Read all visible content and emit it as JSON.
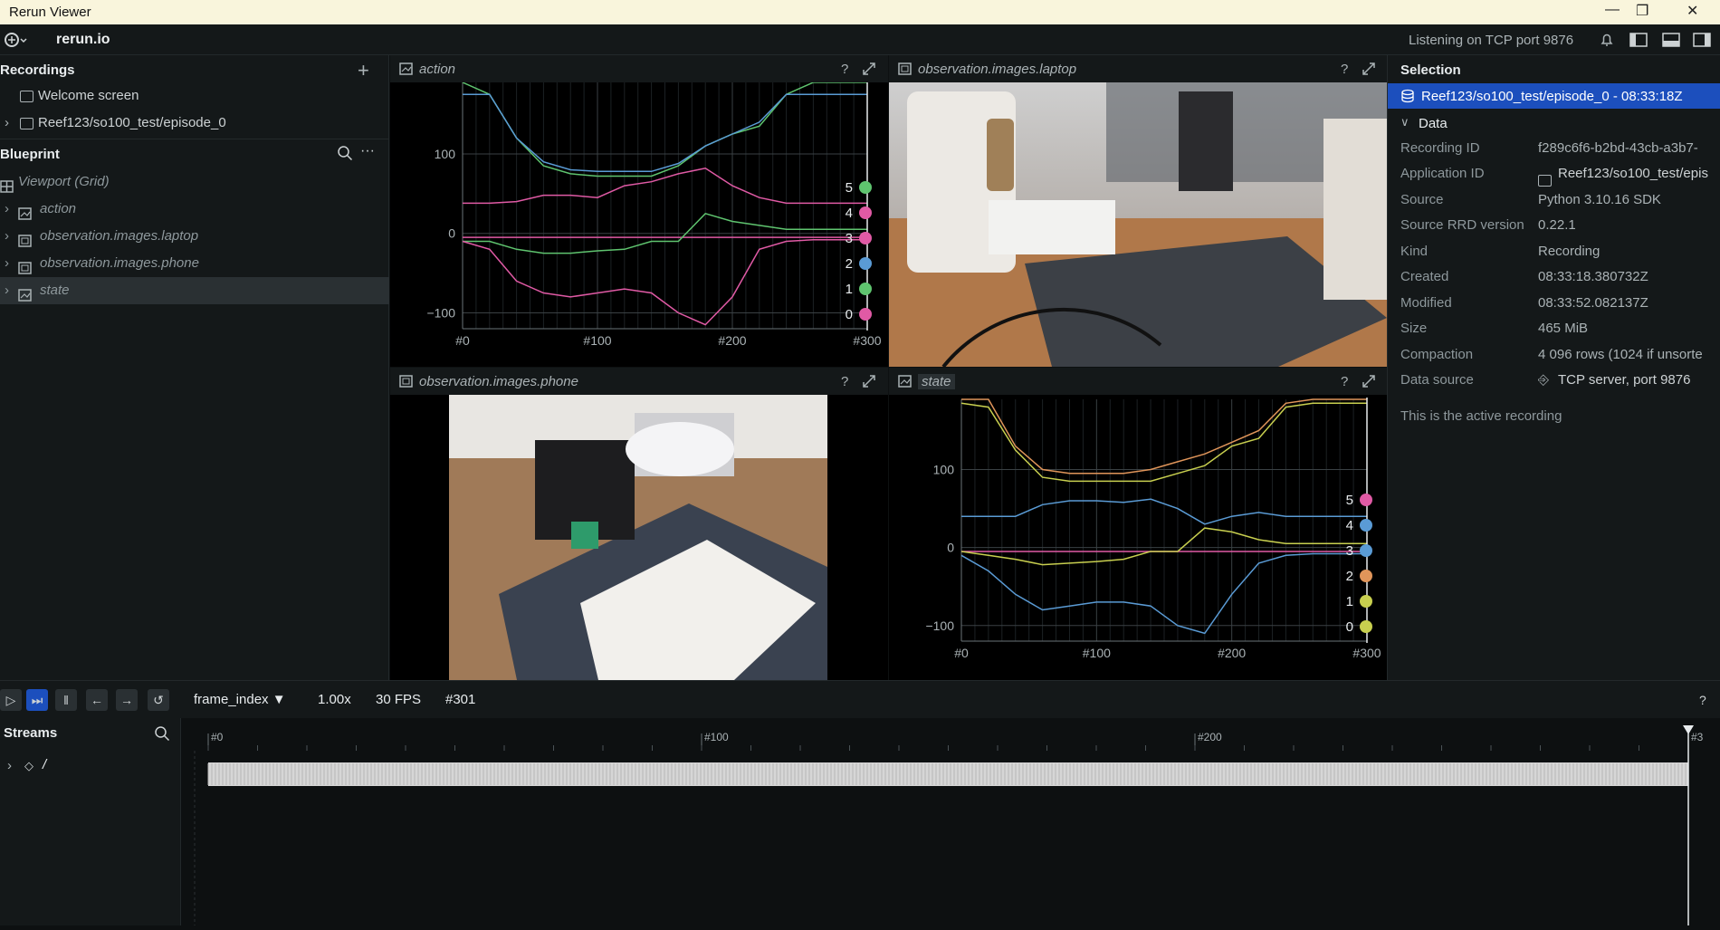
{
  "window": {
    "title": "Rerun Viewer",
    "minimize": "—",
    "restore": "❐",
    "close": "✕"
  },
  "topbar": {
    "logo": "rerun.io",
    "status": "Listening on TCP port 9876"
  },
  "recordings": {
    "header": "Recordings",
    "add_icon": "plus-icon",
    "items": [
      {
        "label": "Welcome screen",
        "icon": "screen-icon"
      },
      {
        "label": "Reef123/so100_test/episode_0",
        "icon": "screen-icon"
      }
    ]
  },
  "blueprint": {
    "header": "Blueprint",
    "items": [
      {
        "label": "Viewport (Grid)",
        "icon": "grid-icon"
      },
      {
        "label": "action",
        "icon": "chart-icon"
      },
      {
        "label": "observation.images.laptop",
        "icon": "image-icon"
      },
      {
        "label": "observation.images.phone",
        "icon": "image-icon"
      },
      {
        "label": "state",
        "icon": "chart-icon"
      }
    ]
  },
  "panels": {
    "action": {
      "title": "action"
    },
    "laptop": {
      "title": "observation.images.laptop"
    },
    "phone": {
      "title": "observation.images.phone"
    },
    "state": {
      "title": "state"
    },
    "help": "?"
  },
  "selection": {
    "header": "Selection",
    "selected": "Reef123/so100_test/episode_0 - 08:33:18Z",
    "section": "Data",
    "rows": [
      {
        "k": "Recording ID",
        "v": "f289c6f6-b2bd-43cb-a3b7-"
      },
      {
        "k": "Application ID",
        "v": "Reef123/so100_test/epis"
      },
      {
        "k": "Source",
        "v": "Python 3.10.16 SDK"
      },
      {
        "k": "Source RRD version",
        "v": "0.22.1"
      },
      {
        "k": "Kind",
        "v": "Recording"
      },
      {
        "k": "Created",
        "v": "08:33:18.380732Z"
      },
      {
        "k": "Modified",
        "v": "08:33:52.082137Z"
      },
      {
        "k": "Size",
        "v": "465 MiB"
      },
      {
        "k": "Compaction",
        "v": "4 096 rows (1024 if unsorte"
      },
      {
        "k": "Data source",
        "v": "TCP server, port 9876"
      }
    ],
    "note": "This is the active recording"
  },
  "timebar": {
    "timeline": "frame_index",
    "speed": "1.00x",
    "fps": "30 FPS",
    "frame": "#301",
    "help": "?"
  },
  "streams": {
    "header": "Streams",
    "root": "/"
  },
  "timeline": {
    "ticks": [
      "#0",
      "#100",
      "#200",
      "#3"
    ]
  },
  "chart_data": [
    {
      "type": "line",
      "panel": "action",
      "x_ticks": [
        "#0",
        "#100",
        "#200",
        "#300"
      ],
      "y_ticks": [
        "100",
        "0",
        "−100"
      ],
      "xlim": [
        0,
        300
      ],
      "ylim": [
        -120,
        190
      ],
      "series": [
        {
          "name": "5",
          "color": "#5fc46f",
          "x": [
            0,
            20,
            40,
            60,
            80,
            100,
            120,
            140,
            160,
            180,
            200,
            220,
            240,
            260,
            280,
            300
          ],
          "y": [
            195,
            175,
            120,
            85,
            75,
            72,
            72,
            72,
            85,
            110,
            125,
            135,
            175,
            195,
            195,
            195
          ]
        },
        {
          "name": "4",
          "color": "#e05aa5",
          "x": [
            0,
            20,
            40,
            60,
            80,
            100,
            120,
            140,
            160,
            180,
            200,
            220,
            240,
            260,
            280,
            300
          ],
          "y": [
            38,
            38,
            40,
            48,
            48,
            45,
            60,
            65,
            75,
            82,
            60,
            45,
            38,
            38,
            38,
            38
          ]
        },
        {
          "name": "3",
          "color": "#e05aa5",
          "x": [
            0,
            20,
            40,
            60,
            80,
            100,
            120,
            140,
            160,
            180,
            200,
            220,
            240,
            260,
            280,
            300
          ],
          "y": [
            -5,
            -5,
            -5,
            -5,
            -5,
            -5,
            -5,
            -5,
            -5,
            -5,
            -5,
            -5,
            -5,
            -5,
            -5,
            -5
          ]
        },
        {
          "name": "2",
          "color": "#5a9bd5",
          "x": [
            0,
            20,
            40,
            60,
            80,
            100,
            120,
            140,
            160,
            180,
            200,
            220,
            240,
            260,
            280,
            300
          ],
          "y": [
            175,
            175,
            120,
            90,
            80,
            78,
            78,
            78,
            88,
            110,
            125,
            140,
            175,
            175,
            175,
            175
          ]
        },
        {
          "name": "1",
          "color": "#5fc46f",
          "x": [
            0,
            20,
            40,
            60,
            80,
            100,
            120,
            140,
            160,
            180,
            200,
            220,
            240,
            260,
            280,
            300
          ],
          "y": [
            -10,
            -10,
            -20,
            -25,
            -25,
            -22,
            -20,
            -10,
            -10,
            25,
            15,
            10,
            5,
            5,
            5,
            5
          ]
        },
        {
          "name": "0",
          "color": "#e05aa5",
          "x": [
            0,
            20,
            40,
            60,
            80,
            100,
            120,
            140,
            160,
            180,
            200,
            220,
            240,
            260,
            280,
            300
          ],
          "y": [
            -10,
            -20,
            -60,
            -75,
            -80,
            -75,
            -70,
            -75,
            -100,
            -115,
            -80,
            -20,
            -10,
            -8,
            -8,
            -8
          ]
        }
      ]
    },
    {
      "type": "line",
      "panel": "state",
      "x_ticks": [
        "#0",
        "#100",
        "#200",
        "#300"
      ],
      "y_ticks": [
        "100",
        "0",
        "−100"
      ],
      "xlim": [
        0,
        300
      ],
      "ylim": [
        -120,
        190
      ],
      "series": [
        {
          "name": "5",
          "color": "#e05aa5",
          "x": [
            0,
            20,
            40,
            60,
            80,
            100,
            120,
            140,
            160,
            180,
            200,
            220,
            240,
            260,
            280,
            300
          ],
          "y": [
            -5,
            -5,
            -5,
            -5,
            -5,
            -5,
            -5,
            -5,
            -5,
            -5,
            -5,
            -5,
            -5,
            -5,
            -5,
            -5
          ]
        },
        {
          "name": "4",
          "color": "#5a9bd5",
          "x": [
            0,
            20,
            40,
            60,
            80,
            100,
            120,
            140,
            160,
            180,
            200,
            220,
            240,
            260,
            280,
            300
          ],
          "y": [
            40,
            40,
            40,
            55,
            60,
            60,
            58,
            62,
            50,
            30,
            40,
            45,
            40,
            40,
            40,
            40
          ]
        },
        {
          "name": "3",
          "color": "#5a9bd5",
          "x": [
            0,
            20,
            40,
            60,
            80,
            100,
            120,
            140,
            160,
            180,
            200,
            220,
            240,
            260,
            280,
            300
          ],
          "y": [
            -10,
            -30,
            -60,
            -80,
            -75,
            -70,
            -70,
            -75,
            -100,
            -110,
            -60,
            -20,
            -10,
            -8,
            -8,
            -8
          ]
        },
        {
          "name": "2",
          "color": "#e0955a",
          "x": [
            0,
            20,
            40,
            60,
            80,
            100,
            120,
            140,
            160,
            180,
            200,
            220,
            240,
            260,
            280,
            300
          ],
          "y": [
            195,
            190,
            130,
            100,
            95,
            95,
            95,
            100,
            110,
            120,
            135,
            150,
            185,
            190,
            190,
            190
          ]
        },
        {
          "name": "1",
          "color": "#c8cf4f",
          "x": [
            0,
            20,
            40,
            60,
            80,
            100,
            120,
            140,
            160,
            180,
            200,
            220,
            240,
            260,
            280,
            300
          ],
          "y": [
            185,
            180,
            125,
            90,
            85,
            85,
            85,
            85,
            95,
            105,
            130,
            140,
            180,
            185,
            185,
            185
          ]
        },
        {
          "name": "0",
          "color": "#c8cf4f",
          "x": [
            0,
            20,
            40,
            60,
            80,
            100,
            120,
            140,
            160,
            180,
            200,
            220,
            240,
            260,
            280,
            300
          ],
          "y": [
            -5,
            -10,
            -15,
            -22,
            -20,
            -18,
            -15,
            -5,
            -5,
            25,
            20,
            10,
            5,
            5,
            5,
            5
          ]
        }
      ]
    }
  ]
}
